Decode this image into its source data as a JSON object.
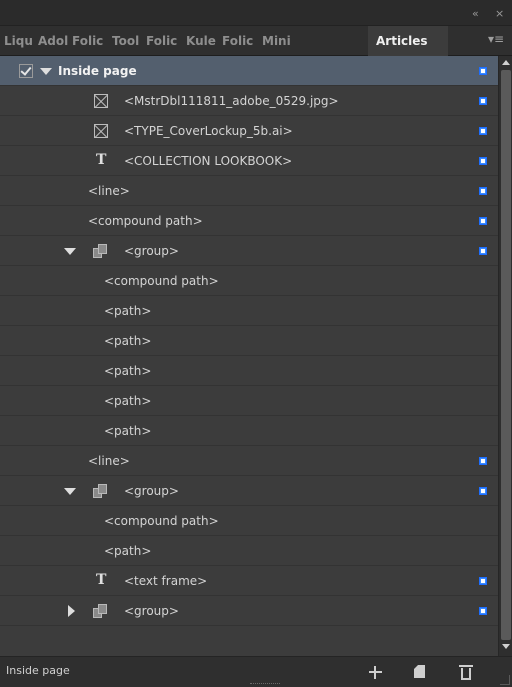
{
  "window": {
    "collapse_glyph": "«",
    "close_glyph": "×"
  },
  "tabs": [
    {
      "label": "Liqu"
    },
    {
      "label": "Adol"
    },
    {
      "label": "Folic"
    },
    {
      "label": "Tool"
    },
    {
      "label": "Folic"
    },
    {
      "label": "Kule"
    },
    {
      "label": "Folic"
    },
    {
      "label": "Mini"
    },
    {
      "label": "Articles"
    }
  ],
  "tab_menu_glyph": "▾≡",
  "rows": [
    {
      "label": "Inside page"
    },
    {
      "label": "<MstrDbl111811_adobe_0529.jpg>"
    },
    {
      "label": "<TYPE_CoverLockup_5b.ai>"
    },
    {
      "label": "<COLLECTION LOOKBOOK>"
    },
    {
      "label": "<line>"
    },
    {
      "label": "<compound path>"
    },
    {
      "label": "<group>"
    },
    {
      "label": "<compound path>"
    },
    {
      "label": "<path>"
    },
    {
      "label": "<path>"
    },
    {
      "label": "<path>"
    },
    {
      "label": "<path>"
    },
    {
      "label": "<path>"
    },
    {
      "label": "<line>"
    },
    {
      "label": "<group>"
    },
    {
      "label": "<compound path>"
    },
    {
      "label": "<path>"
    },
    {
      "label": "<text frame>"
    },
    {
      "label": "<group>"
    }
  ],
  "text_glyph": "T",
  "footer": {
    "status": "Inside page"
  },
  "colors": {
    "selection": "#535f6e",
    "panel": "#3c3c3c",
    "marker": "#1e6eff"
  }
}
